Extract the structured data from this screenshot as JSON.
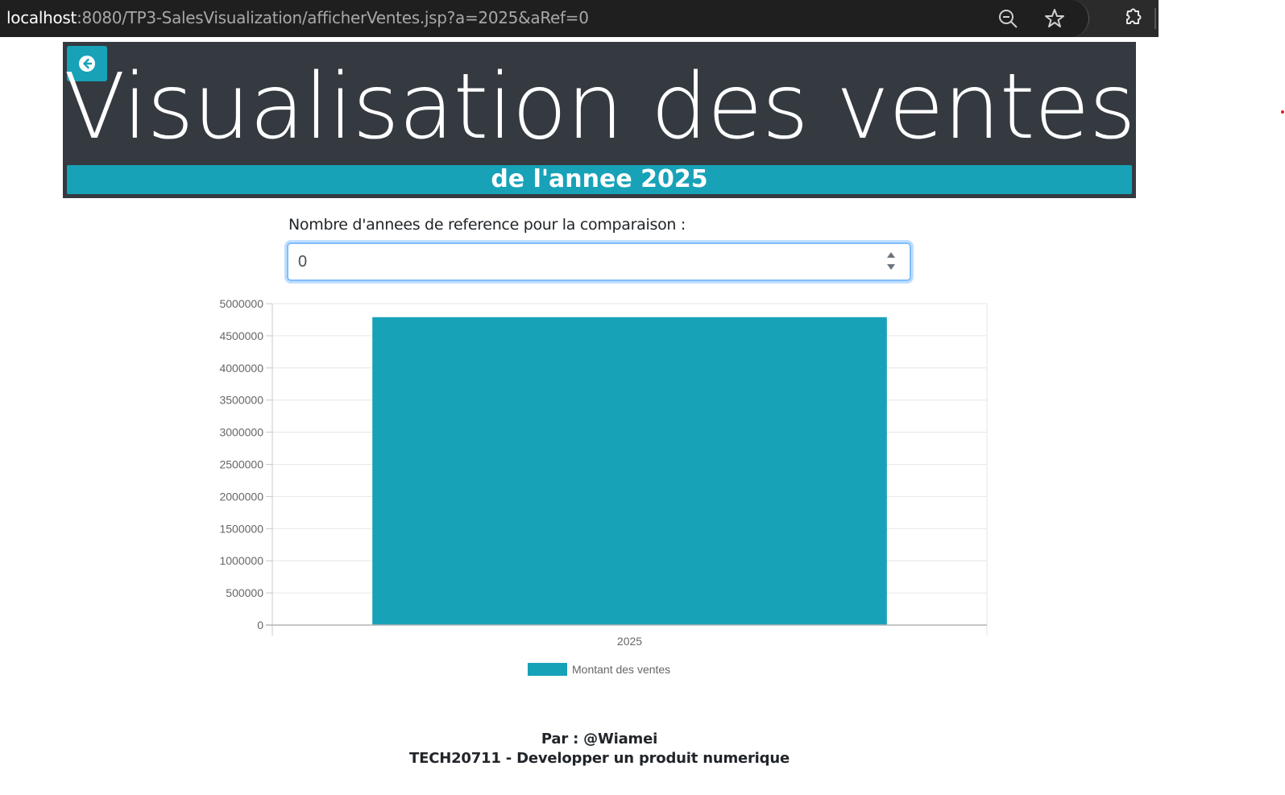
{
  "browser": {
    "url_host": "localhost",
    "url_path": ":8080/TP3-SalesVisualization/afficherVentes.jsp?a=2025&aRef=0",
    "icons": [
      "zoom-out-icon",
      "star-icon",
      "extensions-icon"
    ]
  },
  "header": {
    "title": "Visualisation des ventes",
    "subtitle": "de l'annee 2025",
    "back_icon": "arrow-left-circle-icon"
  },
  "form": {
    "label": "Nombre d'annees de reference pour la comparaison :",
    "value": "0"
  },
  "colors": {
    "accent": "#17a2b8",
    "header_bg": "#343a40"
  },
  "chart_data": {
    "type": "bar",
    "categories": [
      "2025"
    ],
    "series": [
      {
        "name": "Montant des ventes",
        "values": [
          4790000
        ],
        "color": "#17a2b8"
      }
    ],
    "ylim": [
      0,
      5000000
    ],
    "yticks": [
      0,
      500000,
      1000000,
      1500000,
      2000000,
      2500000,
      3000000,
      3500000,
      4000000,
      4500000,
      5000000
    ],
    "grid": true,
    "legend": "bottom"
  },
  "footer": {
    "author": "Par : @Wiamei",
    "course": "TECH20711 - Developper un produit numerique"
  }
}
